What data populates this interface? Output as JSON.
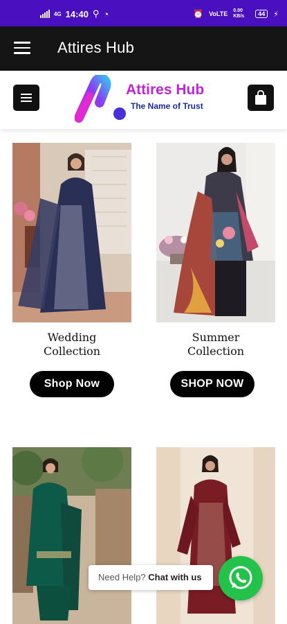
{
  "status_bar": {
    "network_label": "4G",
    "time": "14:40",
    "right_info": "VoLTE",
    "speed": "0.00 KB/s",
    "battery": "44"
  },
  "app_bar": {
    "title": "Attires Hub",
    "menu_icon": "hamburger-icon"
  },
  "site_header": {
    "menu_icon": "menu-icon",
    "cart_icon": "shopping-bag-icon",
    "logo_text": "Attires Hub",
    "logo_tagline": "The Name of Trust"
  },
  "products": [
    {
      "name_line1": "Wedding",
      "name_line2": "Collection",
      "button": "Shop Now"
    },
    {
      "name_line1": "Summer",
      "name_line2": "Collection",
      "button": "SHOP NOW"
    },
    {
      "image": "green-suit-photo"
    },
    {
      "image": "maroon-suit-photo"
    }
  ],
  "help": {
    "prefix": "Need Help?",
    "action": "Chat with us",
    "whatsapp_icon": "whatsapp-icon"
  },
  "colors": {
    "status_bar": "#4a0fbf",
    "app_bar": "#151515",
    "logo_pink": "#c024d8",
    "logo_blue": "#1a2a9a",
    "whatsapp": "#25c24b"
  }
}
